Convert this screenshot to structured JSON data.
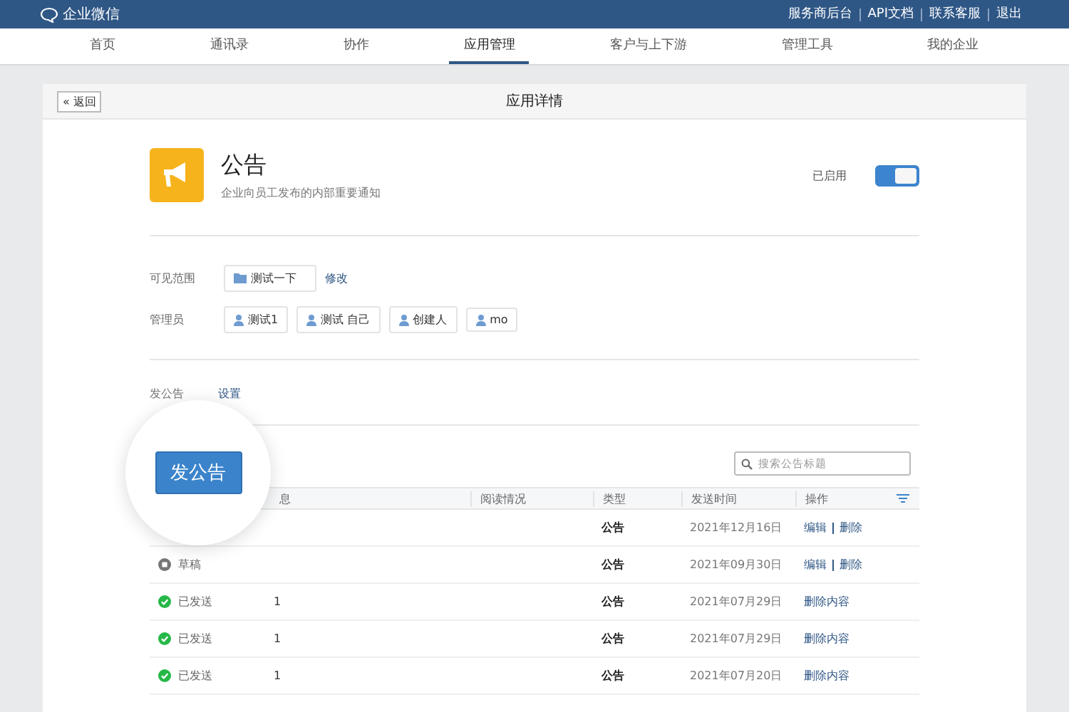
{
  "topbar": {
    "logo": "企业微信",
    "links": [
      "服务商后台",
      "API文档",
      "联系客服",
      "退出"
    ]
  },
  "nav": [
    {
      "label": "首页",
      "selected": false
    },
    {
      "label": "通讯录",
      "selected": false
    },
    {
      "label": "协作",
      "selected": false
    },
    {
      "label": "应用管理",
      "selected": true
    },
    {
      "label": "客户与上下游",
      "selected": false
    },
    {
      "label": "管理工具",
      "selected": false
    },
    {
      "label": "我的企业",
      "selected": false
    }
  ],
  "card": {
    "back_icon": "«",
    "back": "返回",
    "title": "应用详情"
  },
  "app": {
    "name": "公告",
    "description": "企业向员工发布的内部重要通知",
    "status_label": "已启用",
    "enabled": true
  },
  "visibility": {
    "label": "可见范围",
    "value": "测试一下",
    "action": "修改"
  },
  "admins": {
    "label": "管理员",
    "items": [
      "测试1",
      "测试 自己",
      "创建人",
      "mo"
    ]
  },
  "permission": {
    "label": "发公告",
    "action": "设置"
  },
  "publish_button": "发公告",
  "search": {
    "placeholder": "搜索公告标题"
  },
  "table": {
    "columns": [
      "息",
      "阅读情况",
      "类型",
      "发送时间",
      "操作"
    ],
    "rows": [
      {
        "kind": "draft",
        "status": "",
        "message": "",
        "type": "公告",
        "time": "2021年12月16日",
        "actions": [
          "编辑",
          "删除"
        ]
      },
      {
        "kind": "draft",
        "status": "草稿",
        "message": "",
        "type": "公告",
        "time": "2021年09月30日",
        "actions": [
          "编辑",
          "删除"
        ]
      },
      {
        "kind": "sent",
        "status": "已发送",
        "message": "1",
        "type": "公告",
        "time": "2021年07月29日",
        "actions": [
          "删除内容"
        ]
      },
      {
        "kind": "sent",
        "status": "已发送",
        "message": "1",
        "type": "公告",
        "time": "2021年07月29日",
        "actions": [
          "删除内容"
        ]
      },
      {
        "kind": "sent",
        "status": "已发送",
        "message": "1",
        "type": "公告",
        "time": "2021年07月20日",
        "actions": [
          "删除内容"
        ]
      }
    ]
  }
}
